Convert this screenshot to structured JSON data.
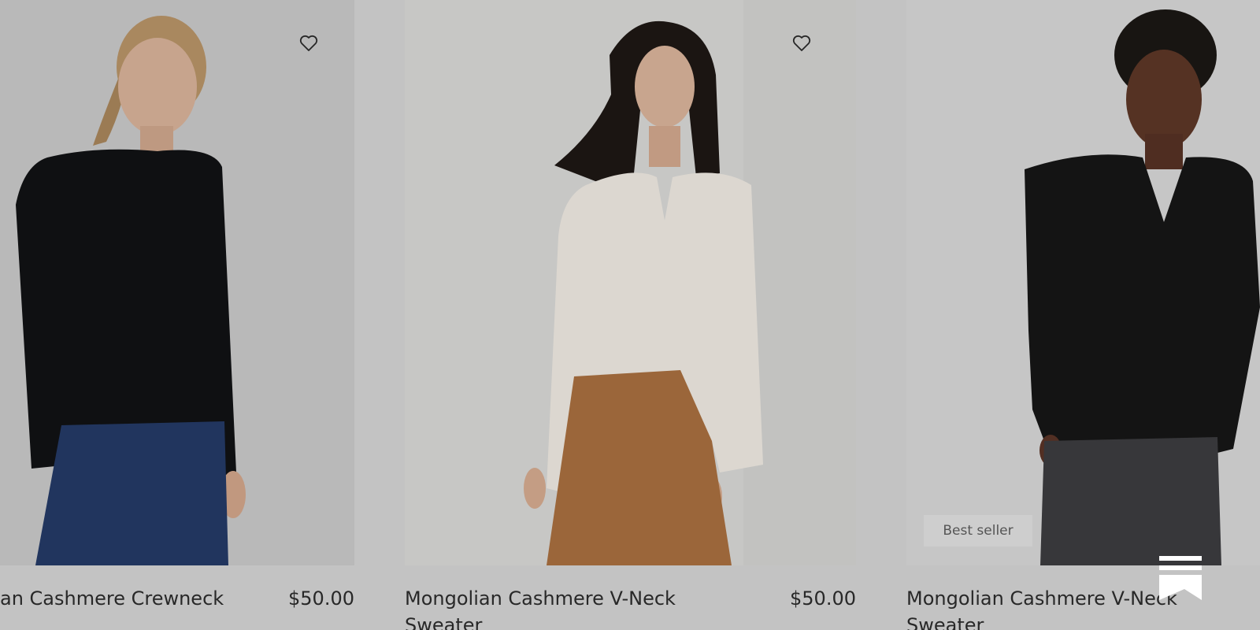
{
  "products": [
    {
      "name": "an Cashmere Crewneck",
      "name_line2": "",
      "price": "$50.00",
      "badge": "",
      "image_icon": "woman-black-crewneck-image",
      "favorite_icon": "heart-icon"
    },
    {
      "name": "Mongolian Cashmere V-Neck",
      "name_line2": "Sweater",
      "price": "$50.00",
      "badge": "",
      "image_icon": "woman-white-vneck-image",
      "favorite_icon": "heart-icon"
    },
    {
      "name": "Mongolian Cashmere V-Neck",
      "name_line2": "Sweater",
      "price": "",
      "badge": "Best seller",
      "image_icon": "woman-black-vneck-image",
      "favorite_icon": ""
    }
  ],
  "overlay_control_icon": "scroll-progress-icon",
  "colors": {
    "background": "#d4d4d4",
    "text": "#2c2c2c",
    "badge_bg": "#e1e1e1",
    "badge_text": "#5d5d5d"
  }
}
